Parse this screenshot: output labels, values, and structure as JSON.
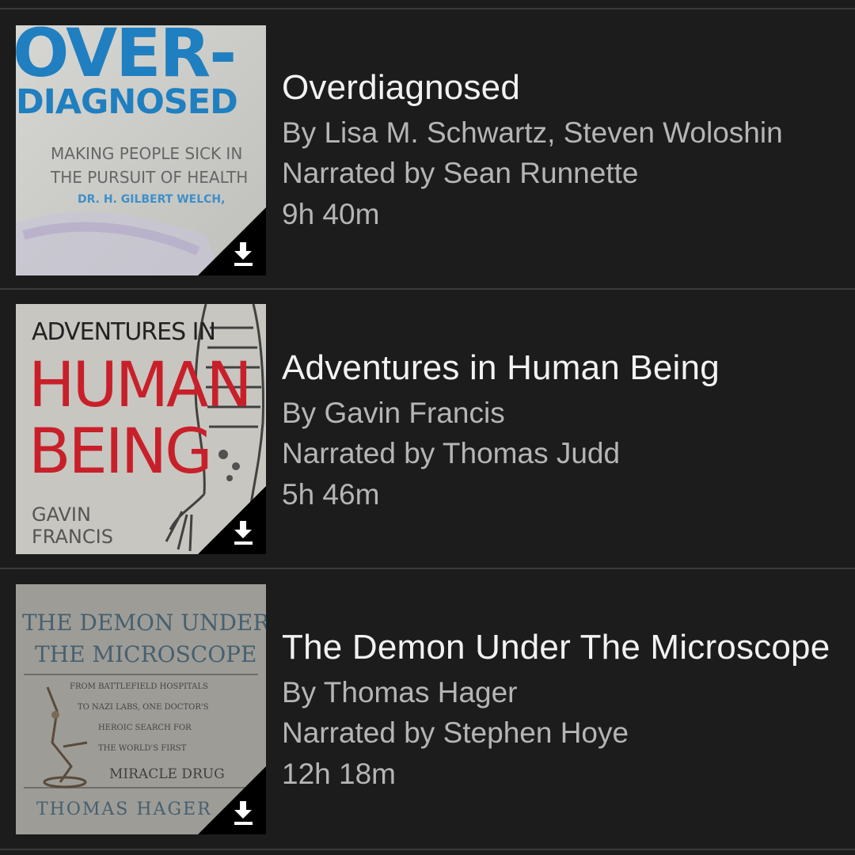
{
  "books": [
    {
      "title": "Overdiagnosed",
      "author": "By Lisa M. Schwartz, Steven Woloshin",
      "narrator": "Narrated by Sean Runnette",
      "duration": "9h 40m",
      "cover": {
        "line1": "OVER-",
        "line2": "DIAGNOSED",
        "line3": "MAKING PEOPLE SICK IN",
        "line4": "THE PURSUIT OF HEALTH",
        "line5": "DR. H. GILBERT WELCH,"
      }
    },
    {
      "title": "Adventures in Human Being",
      "author": "By Gavin Francis",
      "narrator": "Narrated by Thomas Judd",
      "duration": "5h 46m",
      "cover": {
        "line1": "ADVENTURES IN",
        "line2": "HUMAN",
        "line3": "BEING",
        "line4": "GAVIN",
        "line5": "FRANCIS"
      }
    },
    {
      "title": "The Demon Under The Microscope",
      "author": "By Thomas Hager",
      "narrator": "Narrated by Stephen Hoye",
      "duration": "12h 18m",
      "cover": {
        "line1": "THE DEMON UNDER",
        "line2": "THE MICROSCOPE",
        "line3": "FROM BATTLEFIELD HOSPITALS",
        "line4": "TO NAZI LABS, ONE DOCTOR'S",
        "line5": "HEROIC SEARCH FOR",
        "line6": "THE WORLD'S FIRST",
        "line7": "MIRACLE DRUG",
        "line8": "THOMAS HAGER"
      }
    }
  ],
  "colors": {
    "background": "#1c1c1c",
    "separator": "#3a3a3a",
    "title": "#f2f2f2",
    "meta": "#b5b5b5",
    "overdiagnosed_blue": "#1f7fc0",
    "human_being_red": "#c8202a"
  },
  "icons": {
    "download": "download-icon"
  }
}
